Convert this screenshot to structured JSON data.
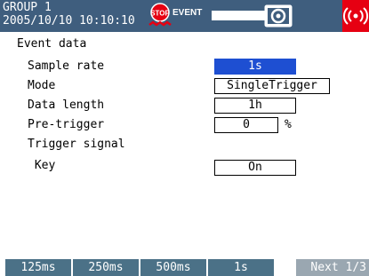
{
  "header": {
    "group": "GROUP 1",
    "datetime": "2005/10/10 10:10:10",
    "stop_icon": "stop-icon",
    "event_label": "EVENT",
    "camera_icon": "camera-icon",
    "alarm_icon": "alarm-icon",
    "colors": {
      "bar": "#3f5e7e",
      "alarm": "#e60012"
    }
  },
  "panel": {
    "title": "Event data",
    "rows": [
      {
        "label": "Sample rate",
        "value": "1s",
        "selected": true
      },
      {
        "label": "Mode",
        "value": "SingleTrigger",
        "selected": false
      },
      {
        "label": "Data length",
        "value": "1h",
        "selected": false
      },
      {
        "label": "Pre-trigger",
        "value": "0",
        "unit": "%",
        "selected": false
      },
      {
        "label": "Trigger signal"
      },
      {
        "label": " Key",
        "value": "On",
        "selected": false
      }
    ]
  },
  "softkeys": [
    {
      "label": "125ms"
    },
    {
      "label": "250ms"
    },
    {
      "label": "500ms"
    },
    {
      "label": "1s"
    },
    {
      "label": "Next 1/3"
    }
  ],
  "colors": {
    "selected": "#1e4fd2",
    "softkey": "#4b7187",
    "softkey_next": "#9aa7b1"
  }
}
